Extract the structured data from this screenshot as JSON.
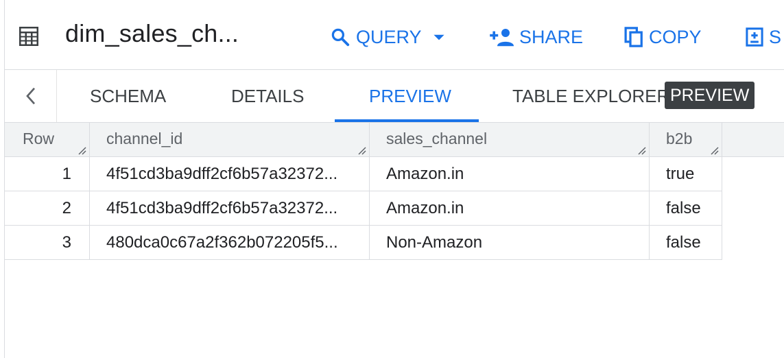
{
  "header": {
    "title": "dim_sales_ch...",
    "actions": {
      "query": "QUERY",
      "share": "SHARE",
      "copy": "COPY",
      "snapshot": "S"
    }
  },
  "tabs": {
    "schema": "SCHEMA",
    "details": "DETAILS",
    "preview": "PREVIEW",
    "table_explorer": "TABLE EXPLORER",
    "badge": "PREVIEW",
    "active": "preview"
  },
  "grid": {
    "columns": [
      "Row",
      "channel_id",
      "sales_channel",
      "b2b"
    ],
    "rows": [
      {
        "row": "1",
        "channel_id": "4f51cd3ba9dff2cf6b57a32372...",
        "sales_channel": "Amazon.in",
        "b2b": "true"
      },
      {
        "row": "2",
        "channel_id": "4f51cd3ba9dff2cf6b57a32372...",
        "sales_channel": "Amazon.in",
        "b2b": "false"
      },
      {
        "row": "3",
        "channel_id": "480dca0c67a2f362b072205f5...",
        "sales_channel": "Non-Amazon",
        "b2b": "false"
      }
    ]
  },
  "colors": {
    "accent": "#1a73e8",
    "text": "#202124",
    "muted": "#5f6368",
    "badge_bg": "#3c4043",
    "header_bg": "#f1f3f4",
    "border": "#dadce0"
  },
  "icons": {
    "table": "table-grid-icon",
    "query": "search-icon",
    "query_menu": "caret-down-icon",
    "share": "person-add-icon",
    "copy": "copy-icon",
    "snapshot": "snapshot-icon",
    "back": "chevron-left-icon",
    "resize": "column-resize-icon"
  }
}
